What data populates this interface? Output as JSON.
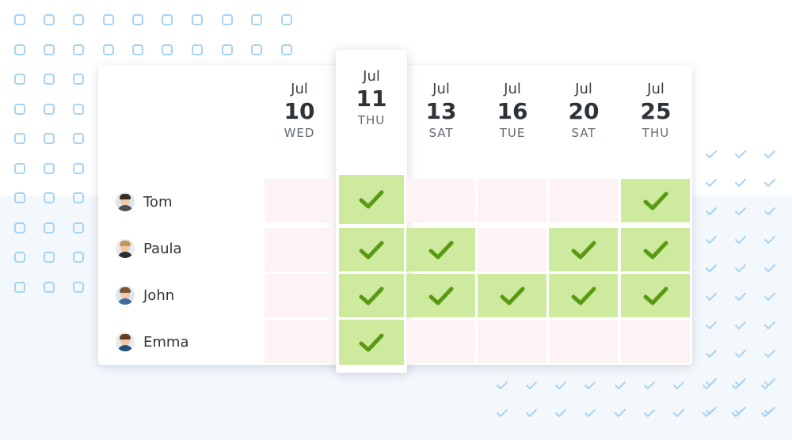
{
  "dates": [
    {
      "month": "Jul",
      "day": "10",
      "weekday": "WED"
    },
    {
      "month": "Jul",
      "day": "11",
      "weekday": "THU"
    },
    {
      "month": "Jul",
      "day": "13",
      "weekday": "SAT"
    },
    {
      "month": "Jul",
      "day": "16",
      "weekday": "TUE"
    },
    {
      "month": "Jul",
      "day": "20",
      "weekday": "SAT"
    },
    {
      "month": "Jul",
      "day": "25",
      "weekday": "THU"
    }
  ],
  "participants": [
    {
      "name": "Tom",
      "icon": "avatar-tom"
    },
    {
      "name": "Paula",
      "icon": "avatar-paula"
    },
    {
      "name": "John",
      "icon": "avatar-john"
    },
    {
      "name": "Emma",
      "icon": "avatar-emma"
    }
  ],
  "availability": [
    [
      false,
      true,
      false,
      false,
      false,
      true
    ],
    [
      false,
      true,
      true,
      false,
      true,
      true
    ],
    [
      false,
      true,
      true,
      true,
      true,
      true
    ],
    [
      false,
      true,
      false,
      false,
      false,
      false
    ]
  ],
  "highlighted_date_index": 1,
  "colors": {
    "available": "#cdea9f",
    "unavailable": "#fdf3f4",
    "check": "#5a9a13",
    "decor": "#a7d3f3"
  }
}
